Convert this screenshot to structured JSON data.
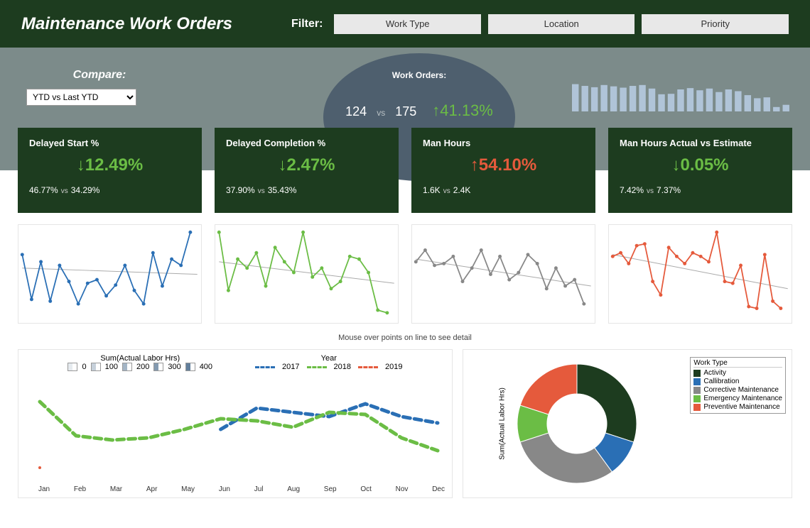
{
  "header": {
    "title": "Maintenance Work Orders",
    "filter_label": "Filter:",
    "filters": [
      "Work Type",
      "Location",
      "Priority"
    ]
  },
  "compare": {
    "label": "Compare:",
    "selected": "YTD vs Last YTD"
  },
  "work_orders": {
    "title": "Work Orders:",
    "a": "124",
    "vs": "vs",
    "b": "175",
    "pct": "↑41.13%"
  },
  "cards": [
    {
      "title": "Delayed Start %",
      "arrow": "↓",
      "pct": "12.49%",
      "color": "green",
      "a": "46.77%",
      "b": "34.29%"
    },
    {
      "title": "Delayed Completion %",
      "arrow": "↓",
      "pct": "2.47%",
      "color": "green",
      "a": "37.90%",
      "b": "35.43%"
    },
    {
      "title": "Man Hours",
      "arrow": "↑",
      "pct": "54.10%",
      "color": "red",
      "a": "1.6K",
      "b": "2.4K"
    },
    {
      "title": "Man Hours Actual vs Estimate",
      "arrow": "↓",
      "pct": "0.05%",
      "color": "green",
      "a": "7.42%",
      "b": "7.37%"
    }
  ],
  "hint": "Mouse over points on line to see detail",
  "trend": {
    "scale_title": "Sum(Actual  Labor Hrs)",
    "scale_values": [
      "0",
      "100",
      "200",
      "300",
      "400"
    ],
    "year_title": "Year",
    "years": [
      {
        "label": "2017",
        "color": "#2a6fb5"
      },
      {
        "label": "2018",
        "color": "#6bbd45"
      },
      {
        "label": "2019",
        "color": "#e55a3c"
      }
    ],
    "months": [
      "Jan",
      "Feb",
      "Mar",
      "Apr",
      "May",
      "Jun",
      "Jul",
      "Aug",
      "Sep",
      "Oct",
      "Nov",
      "Dec"
    ]
  },
  "donut": {
    "ylabel": "Sum(Actual  Labor Hrs)",
    "legend_title": "Work Type",
    "items": [
      {
        "label": "Activity",
        "color": "#1d3c1f"
      },
      {
        "label": "Callibration",
        "color": "#2a6fb5"
      },
      {
        "label": "Corrective Maintenance",
        "color": "#888"
      },
      {
        "label": "Emergency Maintenance",
        "color": "#6bbd45"
      },
      {
        "label": "Preventive Maintenance",
        "color": "#e55a3c"
      }
    ]
  },
  "chart_data": [
    {
      "type": "bar",
      "name": "header-sparkline",
      "values": [
        62,
        58,
        55,
        60,
        57,
        54,
        58,
        60,
        52,
        39,
        40,
        50,
        53,
        48,
        52,
        44,
        50,
        46,
        37,
        30,
        32,
        10,
        15
      ]
    },
    {
      "type": "line",
      "name": "delayed-start-mini",
      "y": [
        70,
        20,
        62,
        18,
        58,
        40,
        15,
        38,
        42,
        24,
        36,
        58,
        30,
        15,
        72,
        35,
        65,
        58,
        95
      ],
      "trend": [
        55,
        48
      ]
    },
    {
      "type": "line",
      "name": "delayed-completion-mini",
      "y": [
        95,
        30,
        65,
        55,
        72,
        35,
        78,
        62,
        50,
        95,
        45,
        55,
        32,
        40,
        68,
        65,
        50,
        8,
        5
      ],
      "trend": [
        62,
        38
      ]
    },
    {
      "type": "line",
      "name": "man-hours-mini",
      "y": [
        62,
        75,
        58,
        60,
        68,
        40,
        55,
        75,
        48,
        68,
        42,
        50,
        70,
        60,
        32,
        55,
        35,
        42,
        15
      ],
      "trend": [
        65,
        35
      ]
    },
    {
      "type": "line",
      "name": "mh-vs-est-mini",
      "y": [
        68,
        72,
        60,
        80,
        82,
        40,
        25,
        78,
        68,
        60,
        72,
        68,
        62,
        95,
        40,
        38,
        58,
        12,
        10,
        70,
        18,
        10
      ],
      "trend": [
        70,
        32
      ]
    },
    {
      "type": "line",
      "name": "labor-trend",
      "x": [
        "Jan",
        "Feb",
        "Mar",
        "Apr",
        "May",
        "Jun",
        "Jul",
        "Aug",
        "Sep",
        "Oct",
        "Nov",
        "Dec"
      ],
      "series": [
        {
          "name": "2017",
          "values": [
            null,
            null,
            null,
            null,
            null,
            200,
            300,
            280,
            260,
            320,
            260,
            230
          ]
        },
        {
          "name": "2018",
          "values": [
            330,
            170,
            150,
            160,
            200,
            250,
            240,
            210,
            280,
            270,
            160,
            100
          ]
        },
        {
          "name": "2019",
          "values": [
            20,
            null,
            null,
            null,
            null,
            null,
            null,
            null,
            null,
            null,
            null,
            null
          ]
        }
      ],
      "ylim": [
        0,
        400
      ]
    },
    {
      "type": "pie",
      "name": "work-type-donut",
      "categories": [
        "Activity",
        "Callibration",
        "Corrective Maintenance",
        "Emergency Maintenance",
        "Preventive Maintenance"
      ],
      "values": [
        30,
        10,
        30,
        10,
        20
      ]
    }
  ]
}
